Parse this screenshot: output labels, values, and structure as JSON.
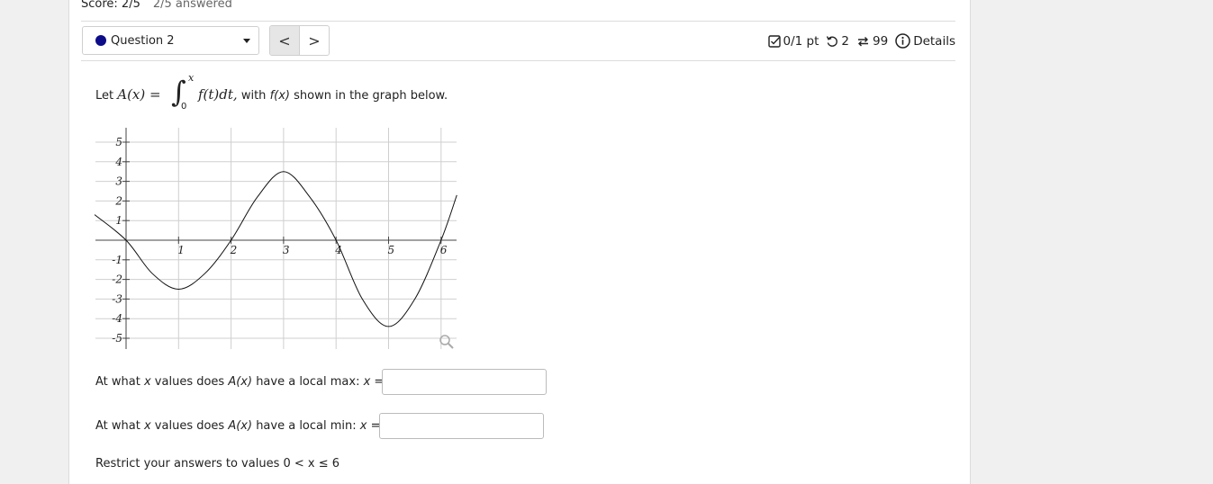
{
  "score": {
    "label": "Score: 2/5",
    "answered": "2/5 answered"
  },
  "question_selector": {
    "label": "Question 2"
  },
  "nav": {
    "prev": "<",
    "next": ">"
  },
  "meta": {
    "points": "0/1 pt",
    "retries": "2",
    "attempts": "99",
    "details": "Details"
  },
  "prompt": {
    "lead": "Let",
    "A_of_x": "A(x) =",
    "upper": "x",
    "lower": "0",
    "integrand": "f(t)dt,",
    "with": "with",
    "fx": "f(x)",
    "tail": "shown in the graph below."
  },
  "chart_data": {
    "type": "line",
    "x_ticks": [
      "1",
      "2",
      "3",
      "4",
      "5",
      "6"
    ],
    "y_ticks_pos": [
      "5",
      "4",
      "3",
      "2",
      "1"
    ],
    "y_ticks_neg": [
      "-1",
      "-2",
      "-3",
      "-4",
      "-5"
    ],
    "xlim": [
      -0.6,
      6.3
    ],
    "ylim": [
      -5.5,
      5.7
    ],
    "grid": true,
    "series": [
      {
        "x": [
          -0.6,
          0,
          0.5,
          1,
          1.5,
          2,
          2.5,
          3,
          3.5,
          4,
          4.5,
          5,
          5.5,
          6,
          6.3
        ],
        "y": [
          1.3,
          0,
          -1.7,
          -2.5,
          -1.7,
          0,
          2.2,
          3.5,
          2.2,
          0,
          -3.0,
          -4.4,
          -3.0,
          0,
          2.3
        ]
      }
    ]
  },
  "questions": {
    "max_pre": "At what ",
    "max_x": "x",
    "max_mid": " values does ",
    "max_A": "A(x)",
    "max_post": " have a local max: ",
    "max_eq": "x =",
    "min_pre": "At what ",
    "min_x": "x",
    "min_mid": " values does ",
    "min_A": "A(x)",
    "min_post": " have a local min: ",
    "min_eq": "x =",
    "restrict": "Restrict your answers to values 0 < x ≤ 6"
  }
}
